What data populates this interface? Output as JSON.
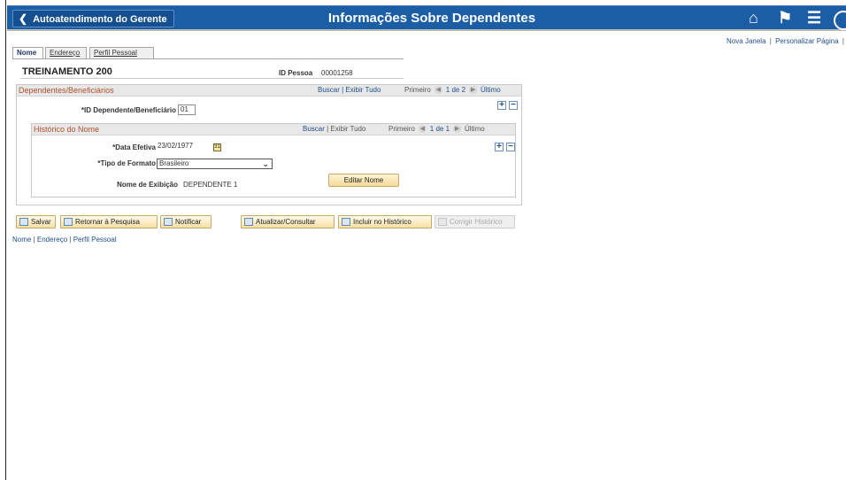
{
  "topbar": {
    "back_label": "Autoatendimento do Gerente",
    "title": "Informações Sobre Dependentes",
    "icons": [
      "home-icon",
      "flag-icon",
      "menu-icon",
      "nav-icon"
    ]
  },
  "util_links": {
    "new_window": "Nova Janela",
    "personalize": "Personalizar Página",
    "sep": "|"
  },
  "tabs": [
    {
      "label": "Nome"
    },
    {
      "label": "Endereço"
    },
    {
      "label": "Perfil Pessoal"
    }
  ],
  "header": {
    "employee_name": "TREINAMENTO 200",
    "id_label": "ID Pessoa",
    "id_value": "00001258"
  },
  "dependents": {
    "title": "Dependentes/Beneficiários",
    "links": "Buscar | Exibir Tudo",
    "nav_first": "Primeiro",
    "nav_count": "1 de 2",
    "nav_last": "Último",
    "id_label": "*ID Dependente/Beneficiário",
    "id_value": "01"
  },
  "name_history": {
    "title": "Histórico do Nome",
    "link_search": "Buscar",
    "link_view": "Exibir Tudo",
    "nav_first": "Primeiro",
    "nav_count": "1 de 1",
    "nav_last": "Último",
    "effective_date_label": "*Data Efetiva",
    "effective_date_value": "23/02/1977",
    "format_type_label": "*Tipo de Formato",
    "format_type_value": "Brasileiro",
    "display_name_label": "Nome de Exibição",
    "display_name_value": "DEPENDENTE 1",
    "edit_name_button": "Editar Nome"
  },
  "toolbar": {
    "save": "Salvar",
    "return_search": "Retornar à Pesquisa",
    "notify": "Notificar",
    "update_display": "Atualizar/Consultar",
    "include_history": "Incluir no Histórico",
    "correct_history": "Corrigir Histórico"
  },
  "bottom_links": {
    "name": "Nome",
    "address": "Endereço",
    "personal_profile": "Perfil Pessoal",
    "sep": "|"
  },
  "colors": {
    "header_blue": "#1c5ea6",
    "section_title": "#b0502b",
    "link_blue": "#1f4e8c"
  }
}
